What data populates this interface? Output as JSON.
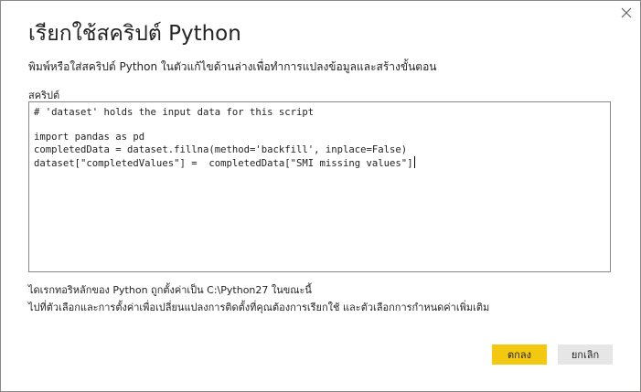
{
  "dialog": {
    "title": "เรียกใช้สคริปต์ Python",
    "description": "พิมพ์หรือใส่สคริปต์ Python ในตัวแก้ไขด้านล่างเพื่อทำการแปลงข้อมูลและสร้างขั้นตอน",
    "close_icon": "close-icon"
  },
  "editor": {
    "label": "สคริปต์",
    "lines": [
      "# 'dataset' holds the input data for this script",
      "",
      "import pandas as pd",
      "completedData = dataset.fillna(method='backfill', inplace=False)",
      "dataset[\"completedValues\"] =  completedData[\"SMI missing values\"]"
    ]
  },
  "notes": {
    "python_home": "ไดเรกทอริหลักของ Python ถูกตั้งค่าเป็น C:\\Python27 ในขณะนี้",
    "options_hint": "ไปที่ตัวเลือกและการตั้งค่าเพื่อเปลี่ยนแปลงการติดตั้งที่คุณต้องการเรียกใช้ และตัวเลือกการกำหนดค่าเพิ่มเติม"
  },
  "buttons": {
    "ok_label": "ตกลง",
    "cancel_label": "ยกเลิก"
  },
  "colors": {
    "accent": "#f2c811",
    "secondary_button": "#e6e6e6",
    "border": "#8a8886"
  }
}
